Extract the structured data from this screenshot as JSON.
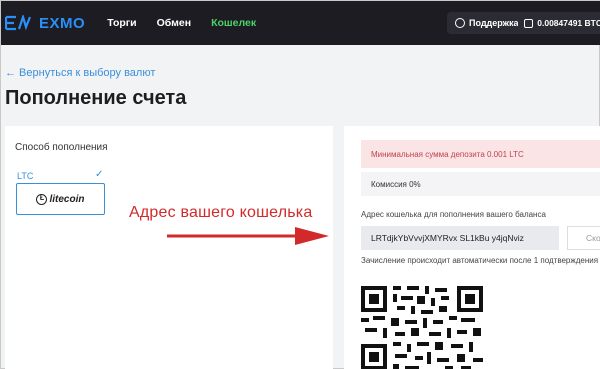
{
  "header": {
    "logo_text": "EXMO",
    "nav": [
      {
        "label": "Торги"
      },
      {
        "label": "Обмен"
      },
      {
        "label": "Кошелек",
        "active": true
      }
    ],
    "support_label": "Поддержка",
    "balance_label": "0.00847491 BTC",
    "accent_color": "#2a8ff7",
    "active_color": "#4cd468"
  },
  "page": {
    "back_link": "← Вернуться к выбору валют",
    "title": "Пополнение счета"
  },
  "left_panel": {
    "method_label": "Способ пополнения",
    "currency_code": "LTC",
    "check_icon": "checkmark-icon",
    "logo_text": "litecoin"
  },
  "annotation": {
    "text": "Адрес  вашего кошелька",
    "color": "#d22a2a"
  },
  "right_panel": {
    "min_deposit": "Минимальная сумма депозита 0.001 LTC",
    "fee": "Комиссия 0%",
    "address_label": "Адрес кошелька для пополнения вашего баланса",
    "address_value": "LRTdjkYbVvvjXMYRvx  SL1kBu  y4jqNviz",
    "copy_label": "Ско",
    "note": "Зачисление происходит автоматически после 1 подтверждения",
    "qr_icon": "qr-code-icon"
  }
}
